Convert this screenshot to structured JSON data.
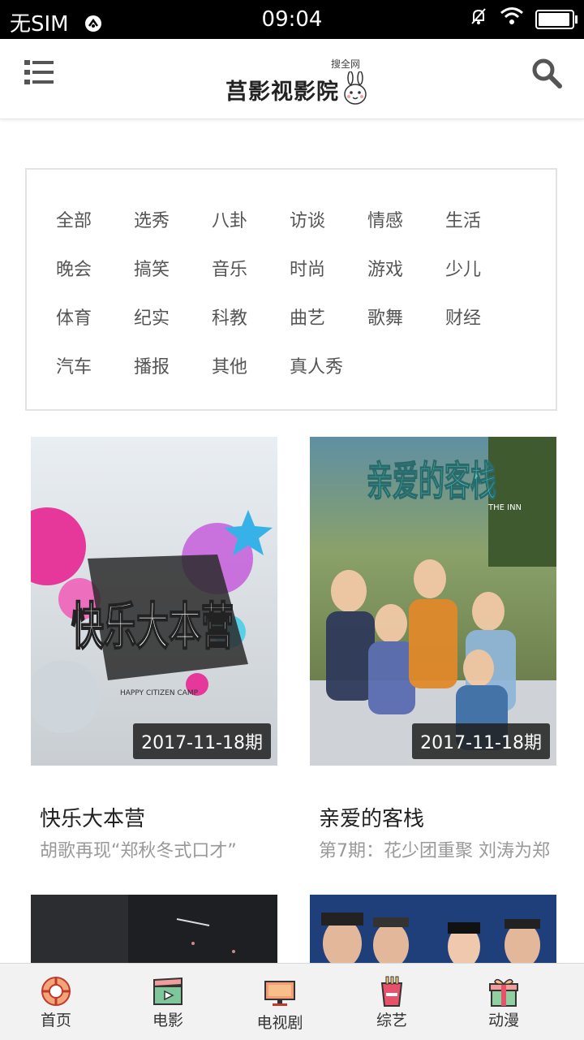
{
  "status_bar": {
    "carrier": "无SIM",
    "time": "09:04"
  },
  "header": {
    "logo_title": "莒影视影院",
    "logo_sub": "搜全网"
  },
  "categories": [
    "全部",
    "选秀",
    "八卦",
    "访谈",
    "情感",
    "生活",
    "晚会",
    "搞笑",
    "音乐",
    "时尚",
    "游戏",
    "少儿",
    "体育",
    "纪实",
    "科教",
    "曲艺",
    "歌舞",
    "财经",
    "汽车",
    "播报",
    "其他",
    "真人秀"
  ],
  "cards": [
    {
      "title": "快乐大本营",
      "desc": "胡歌再现“郑秋冬式口才”",
      "badge": "2017-11-18期",
      "poster_logo": "快乐大本营",
      "poster_sub": "HAPPY CITIZEN CAMP"
    },
    {
      "title": "亲爱的客栈",
      "desc": "第7期：花少团重聚 刘涛为郑",
      "badge": "2017-11-18期",
      "poster_logo": "亲爱的客栈",
      "poster_sub": "THE INN"
    }
  ],
  "tabs": [
    {
      "label": "首页",
      "icon": "home-lifebuoy-icon"
    },
    {
      "label": "电影",
      "icon": "clapperboard-icon"
    },
    {
      "label": "电视剧",
      "icon": "tv-icon"
    },
    {
      "label": "综艺",
      "icon": "popcorn-icon"
    },
    {
      "label": "动漫",
      "icon": "gift-icon"
    }
  ]
}
